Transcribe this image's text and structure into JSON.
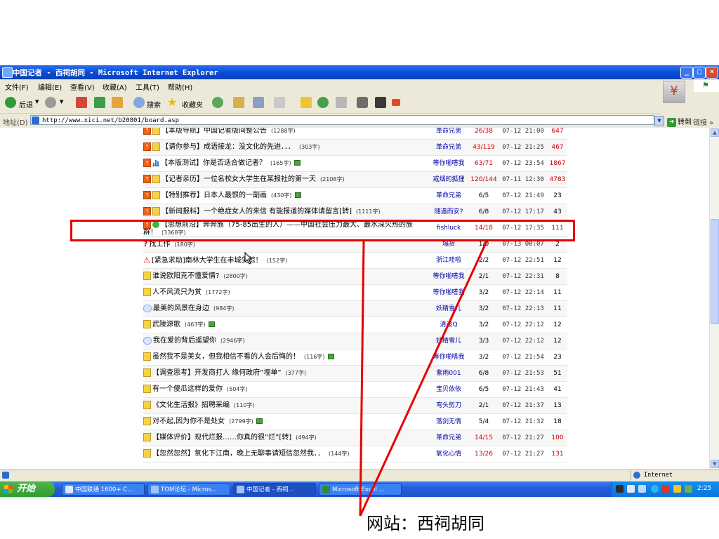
{
  "window": {
    "title": "中国记者 - 西祠胡同 - Microsoft Internet Explorer"
  },
  "menu": [
    "文件(F)",
    "编辑(E)",
    "查看(V)",
    "收藏(A)",
    "工具(T)",
    "帮助(H)"
  ],
  "toolbar": {
    "back": "后退",
    "search": "搜索",
    "favorites": "收藏夹"
  },
  "address": {
    "label": "地址(D)",
    "url": "http://www.xici.net/b20801/board.asp",
    "go": "转到",
    "links": "链接"
  },
  "posts": [
    {
      "icons": [
        "up",
        "doc"
      ],
      "title": "【本版导航】中国记者版间整公告",
      "size": "(1288字)",
      "author": "革命兄弟",
      "replies": "26/38",
      "hot_reply": true,
      "time": "07-12 21:00",
      "views": "647",
      "hot_views": true,
      "pic": false
    },
    {
      "icons": [
        "up",
        "doc"
      ],
      "title": "【请你参与】成语接龙：没文化的先进．．．",
      "size": "(303字)",
      "author": "革命兄弟",
      "replies": "43/119",
      "hot_reply": true,
      "time": "07-12 21:25",
      "views": "467",
      "hot_views": true,
      "pic": false
    },
    {
      "icons": [
        "up",
        "chart"
      ],
      "title": "【本版测试】你是否适合做记者？",
      "size": "(165字)",
      "author": "等你啪嗒我",
      "replies": "63/71",
      "hot_reply": true,
      "time": "07-12 23:54",
      "views": "1867",
      "hot_views": true,
      "pic": true
    },
    {
      "icons": [
        "up",
        "doc"
      ],
      "title": "【记者亲历】一位名校女大学生在某报社的第一天",
      "size": "(2108字)",
      "author": "戒烟的狐狸",
      "replies": "120/144",
      "hot_reply": true,
      "time": "07-11 12:30",
      "views": "4783",
      "hot_views": true,
      "pic": false
    },
    {
      "icons": [
        "up",
        "doc"
      ],
      "title": "【特别推荐】日本人最恨的一副画",
      "size": "(430字)",
      "author": "革命兄弟",
      "replies": "6/5",
      "hot_reply": false,
      "time": "07-12 21:49",
      "views": "23",
      "hot_views": false,
      "pic": true
    },
    {
      "icons": [
        "up",
        "doc"
      ],
      "title": "【新闻报料】一个绝症女人的来信 有能报道的媒体请留言[转]",
      "size": "(1111字)",
      "author": "随遇而安?",
      "replies": "6/8",
      "hot_reply": false,
      "time": "07-12 17:17",
      "views": "43",
      "hot_views": false,
      "pic": false
    },
    {
      "icons": [
        "up",
        "smile"
      ],
      "title": "【思想前沿】奔奔族（75-85出生的人）——中国社会压力最大、最水深火热的族群！",
      "size": "(3368字)",
      "author": "fishluck",
      "replies": "14/18",
      "hot_reply": true,
      "time": "07-12 17:35",
      "views": "111",
      "hot_views": true,
      "pic": false,
      "two_line": true
    },
    {
      "icons": [
        "question"
      ],
      "title": "找工作",
      "size": "(180字)",
      "author": "塌货",
      "replies": "1/0",
      "hot_reply": false,
      "time": "07-13 00:07",
      "views": "2",
      "hot_views": false,
      "pic": false
    },
    {
      "icons": [
        "warning"
      ],
      "title": "[紧急求助]南林大学生在丰城失踪！",
      "size": "(152字)",
      "author": "浙江哇啦",
      "replies": "2/2",
      "hot_reply": false,
      "time": "07-12 22:51",
      "views": "12",
      "hot_views": false,
      "pic": false
    },
    {
      "icons": [
        "doc"
      ],
      "title": "谁说欧阳克不懂爱情?",
      "size": "(2800字)",
      "author": "等你啪嗒我",
      "replies": "2/1",
      "hot_reply": false,
      "time": "07-12 22:31",
      "views": "8",
      "hot_views": false,
      "pic": false
    },
    {
      "icons": [
        "doc"
      ],
      "title": "人不风流只为贫",
      "size": "(1772字)",
      "author": "等你啪嗒我",
      "replies": "3/2",
      "hot_reply": false,
      "time": "07-12 22:14",
      "views": "11",
      "hot_views": false,
      "pic": false
    },
    {
      "icons": [
        "chat"
      ],
      "title": "最美的风景在身边",
      "size": "(984字)",
      "author": "妖精雪儿",
      "replies": "3/2",
      "hot_reply": false,
      "time": "07-12 22:13",
      "views": "11",
      "hot_views": false,
      "pic": false
    },
    {
      "icons": [
        "doc"
      ],
      "title": "武陵源歌",
      "size": "(463字)",
      "author": "清波Q",
      "replies": "3/2",
      "hot_reply": false,
      "time": "07-12 22:12",
      "views": "12",
      "hot_views": false,
      "pic": true
    },
    {
      "icons": [
        "chat"
      ],
      "title": "我在爱的背后遥望你",
      "size": "(2946字)",
      "author": "妖精雪儿",
      "replies": "3/3",
      "hot_reply": false,
      "time": "07-12 22:12",
      "views": "12",
      "hot_views": false,
      "pic": false
    },
    {
      "icons": [
        "doc"
      ],
      "title": "虽然我不是美女，但我相信不看的人会后悔的！",
      "size": "(116字)",
      "author": "等你啪嗒我",
      "replies": "3/2",
      "hot_reply": false,
      "time": "07-12 21:54",
      "views": "23",
      "hot_views": false,
      "pic": true
    },
    {
      "icons": [
        "doc"
      ],
      "title": "【调查思考】开发商打人 缘何政府“埋单”",
      "size": "(377字)",
      "author": "紫雨001",
      "replies": "6/8",
      "hot_reply": false,
      "time": "07-12 21:53",
      "views": "51",
      "hot_views": false,
      "pic": false
    },
    {
      "icons": [
        "doc"
      ],
      "title": "有一个傻瓜这样的爱你",
      "size": "(504字)",
      "author": "宝贝依依",
      "replies": "6/5",
      "hot_reply": false,
      "time": "07-12 21:43",
      "views": "41",
      "hot_views": false,
      "pic": false
    },
    {
      "icons": [
        "doc"
      ],
      "title": "《文化生活报》招聘采编",
      "size": "(110字)",
      "author": "弯头剪刀",
      "replies": "2/1",
      "hot_reply": false,
      "time": "07-12 21:37",
      "views": "13",
      "hot_views": false,
      "pic": false
    },
    {
      "icons": [
        "doc"
      ],
      "title": "对不起,因为你不是处女",
      "size": "(2799字)",
      "author": "落剑无情",
      "replies": "5/4",
      "hot_reply": false,
      "time": "07-12 21:32",
      "views": "18",
      "hot_views": false,
      "pic": true
    },
    {
      "icons": [
        "doc"
      ],
      "title": "【媒体评价】现代烂报……你真的很“烂”[转]",
      "size": "(494字)",
      "author": "革命兄弟",
      "replies": "14/15",
      "hot_reply": true,
      "time": "07-12 21:27",
      "views": "100",
      "hot_views": true,
      "pic": false
    },
    {
      "icons": [
        "doc"
      ],
      "title": "【忽然忽然】氧化下江南，晚上无聊事请短信忽然我．．",
      "size": "(144字)",
      "author": "氧化心情",
      "replies": "13/26",
      "hot_reply": true,
      "time": "07-12 21:27",
      "views": "131",
      "hot_views": true,
      "pic": false
    }
  ],
  "status": {
    "zone": "Internet"
  },
  "taskbar": {
    "start": "开始",
    "tasks": [
      "中国联通 1600+ C...",
      "TOM论坛 - Micros...",
      "中国记者 - 西祠...",
      "Microsoft Excel ..."
    ],
    "clock": "2:25"
  },
  "caption": "网站：西祠胡同"
}
